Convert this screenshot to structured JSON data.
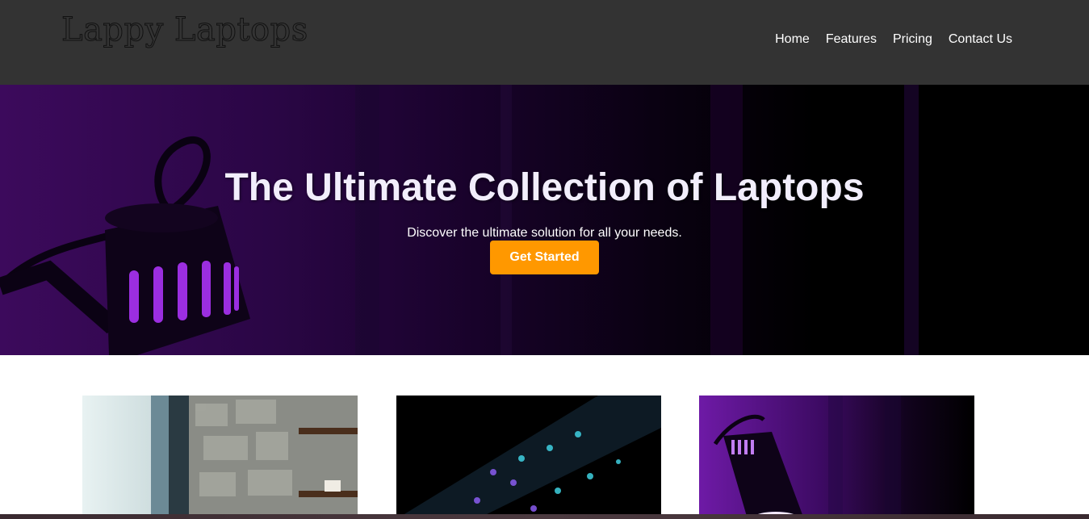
{
  "header": {
    "logo_text": "Lappy Laptops",
    "nav": [
      "Home",
      "Features",
      "Pricing",
      "Contact Us"
    ]
  },
  "hero": {
    "title": "The Ultimate Collection of Laptops",
    "subtitle": "Discover the ultimate solution for all your needs.",
    "cta_label": "Get Started"
  },
  "colors": {
    "header_bg": "#333333",
    "accent": "#ff9800",
    "hero_purple": "#3c0a5c"
  },
  "cards": [
    {
      "image": "laptop-on-stone-desk-photo"
    },
    {
      "image": "rgb-keyboard-photo"
    },
    {
      "image": "purple-desk-lamp-photo"
    }
  ]
}
